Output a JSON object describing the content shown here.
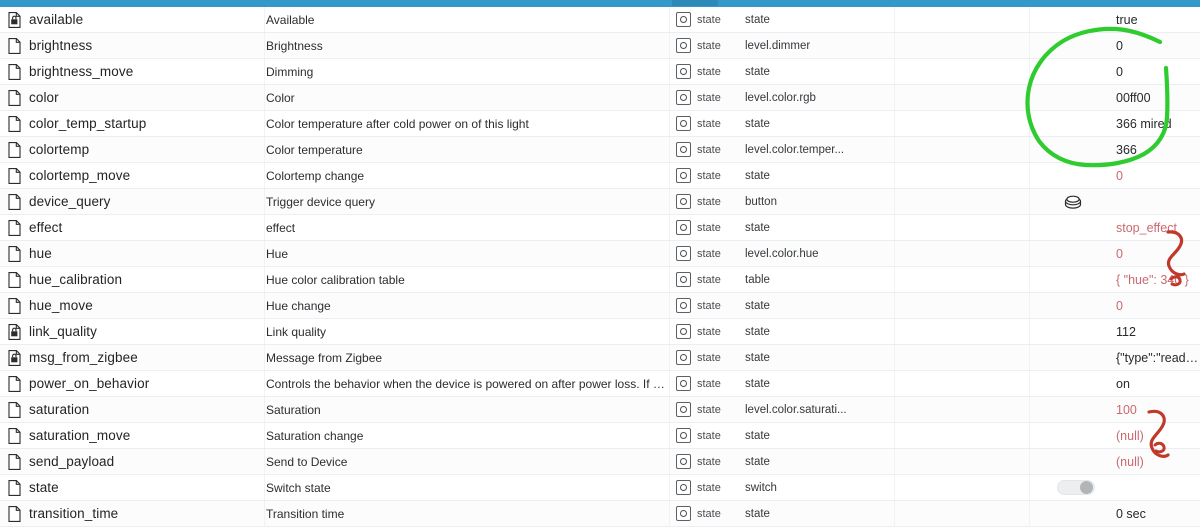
{
  "header": {
    "bar_color": "#3498c8"
  },
  "columns": {
    "name": "",
    "description": "",
    "access": "",
    "type": "",
    "value": ""
  },
  "rows": [
    {
      "icon": "document-lock-icon",
      "name": "available",
      "description": "Available",
      "access_label": "state",
      "type": "state",
      "value": "true",
      "value_kind": "text",
      "value_muted": false
    },
    {
      "icon": "document-icon",
      "name": "brightness",
      "description": "Brightness",
      "access_label": "state",
      "type": "level.dimmer",
      "value": "0",
      "value_kind": "text",
      "value_muted": false
    },
    {
      "icon": "document-icon",
      "name": "brightness_move",
      "description": "Dimming",
      "access_label": "state",
      "type": "state",
      "value": "0",
      "value_kind": "text",
      "value_muted": false
    },
    {
      "icon": "document-icon",
      "name": "color",
      "description": "Color",
      "access_label": "state",
      "type": "level.color.rgb",
      "value": "00ff00",
      "value_kind": "text",
      "value_muted": false
    },
    {
      "icon": "document-icon",
      "name": "color_temp_startup",
      "description": "Color temperature after cold power on of this light",
      "access_label": "state",
      "type": "state",
      "value": "366 mired",
      "value_kind": "text",
      "value_muted": false
    },
    {
      "icon": "document-icon",
      "name": "colortemp",
      "description": "Color temperature",
      "access_label": "state",
      "type": "level.color.temper...",
      "value": "366",
      "value_kind": "text",
      "value_muted": false
    },
    {
      "icon": "document-icon",
      "name": "colortemp_move",
      "description": "Colortemp change",
      "access_label": "state",
      "type": "state",
      "value": "0",
      "value_kind": "text",
      "value_muted": true
    },
    {
      "icon": "document-icon",
      "name": "device_query",
      "description": "Trigger device query",
      "access_label": "state",
      "type": "button",
      "value": "",
      "value_kind": "button-icon",
      "value_muted": false
    },
    {
      "icon": "document-icon",
      "name": "effect",
      "description": "effect",
      "access_label": "state",
      "type": "state",
      "value": "stop_effect",
      "value_kind": "text",
      "value_muted": true
    },
    {
      "icon": "document-icon",
      "name": "hue",
      "description": "Hue",
      "access_label": "state",
      "type": "level.color.hue",
      "value": "0",
      "value_kind": "text",
      "value_muted": true
    },
    {
      "icon": "document-icon",
      "name": "hue_calibration",
      "description": "Hue color calibration table",
      "access_label": "state",
      "type": "table",
      "value": "{ \"hue\": 340 }",
      "value_kind": "text",
      "value_muted": true
    },
    {
      "icon": "document-icon",
      "name": "hue_move",
      "description": "Hue change",
      "access_label": "state",
      "type": "state",
      "value": "0",
      "value_kind": "text",
      "value_muted": true
    },
    {
      "icon": "document-lock-icon",
      "name": "link_quality",
      "description": "Link quality",
      "access_label": "state",
      "type": "state",
      "value": "112",
      "value_kind": "text",
      "value_muted": false
    },
    {
      "icon": "document-lock-icon",
      "name": "msg_from_zigbee",
      "description": "Message from Zigbee",
      "access_label": "state",
      "type": "state",
      "value": "{\"type\":\"readRes...",
      "value_kind": "text",
      "value_muted": false
    },
    {
      "icon": "document-icon",
      "name": "power_on_behavior",
      "description": "Controls the behavior when the device is powered on after power loss. If you g...",
      "access_label": "state",
      "type": "state",
      "value": "on",
      "value_kind": "text",
      "value_muted": false
    },
    {
      "icon": "document-icon",
      "name": "saturation",
      "description": "Saturation",
      "access_label": "state",
      "type": "level.color.saturati...",
      "value": "100",
      "value_kind": "text",
      "value_muted": true
    },
    {
      "icon": "document-icon",
      "name": "saturation_move",
      "description": "Saturation change",
      "access_label": "state",
      "type": "state",
      "value": "(null)",
      "value_kind": "text",
      "value_muted": true
    },
    {
      "icon": "document-icon",
      "name": "send_payload",
      "description": "Send to Device",
      "access_label": "state",
      "type": "state",
      "value": "(null)",
      "value_kind": "text",
      "value_muted": true
    },
    {
      "icon": "document-icon",
      "name": "state",
      "description": "Switch state",
      "access_label": "state",
      "type": "switch",
      "value": "",
      "value_kind": "toggle-off",
      "value_muted": false
    },
    {
      "icon": "document-icon",
      "name": "transition_time",
      "description": "Transition time",
      "access_label": "state",
      "type": "state",
      "value": "0 sec",
      "value_kind": "text",
      "value_muted": false
    }
  ],
  "annotations": {
    "green_circle": {
      "name": "green-circle-annotation",
      "color": "#2ecc2e",
      "encircles": [
        "0",
        "0",
        "00ff00",
        "366 mired",
        "366"
      ]
    },
    "red_brace_top": {
      "name": "red-brace-annotation-top",
      "color": "#c0392b",
      "marks": [
        "stop_effect",
        "0",
        "{ \"hue\": 340 }"
      ]
    },
    "red_brace_bottom": {
      "name": "red-brace-annotation-bottom",
      "color": "#c0392b",
      "marks": [
        "100",
        "(null)"
      ]
    }
  }
}
